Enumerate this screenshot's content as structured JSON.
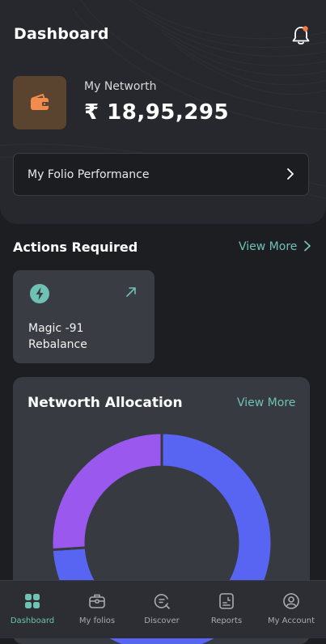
{
  "header": {
    "title": "Dashboard",
    "bell_icon": "bell-icon",
    "notification_dot_color": "#ff7a3d"
  },
  "networth": {
    "label": "My Networth",
    "value": "₹ 18,95,295",
    "icon": "wallet-icon"
  },
  "folio_performance": {
    "label": "My Folio Performance",
    "icon": "chevron-right-icon"
  },
  "actions": {
    "title": "Actions Required",
    "view_more": "View More",
    "cards": [
      {
        "name": "Magic -91 Rebalance",
        "icon": "lightning-icon"
      }
    ]
  },
  "allocation": {
    "title": "Networth Allocation",
    "view_more": "View More"
  },
  "chart_data": {
    "type": "pie",
    "variant": "donut",
    "slices": [
      {
        "value": 0.74,
        "color": "#5765f2"
      },
      {
        "value": 0.26,
        "color": "#9a58ee"
      }
    ]
  },
  "colors": {
    "accent": "#6fc1b4",
    "background": "#1d1e22",
    "card": "#373a41"
  },
  "nav": {
    "items": [
      {
        "label": "Dashboard",
        "icon": "dashboard-grid-icon",
        "active": true
      },
      {
        "label": "My folios",
        "icon": "briefcase-icon",
        "active": false
      },
      {
        "label": "Discover",
        "icon": "discover-search-icon",
        "active": false
      },
      {
        "label": "Reports",
        "icon": "report-icon",
        "active": false
      },
      {
        "label": "My Account",
        "icon": "account-icon",
        "active": false
      }
    ]
  }
}
